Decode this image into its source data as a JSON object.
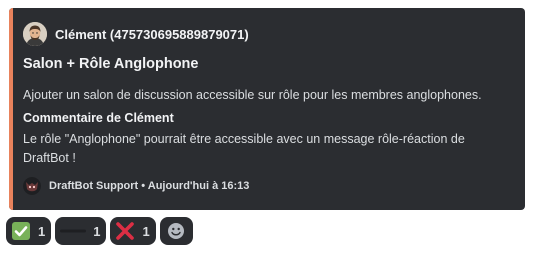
{
  "embed": {
    "accent_color": "#e8825c",
    "author": {
      "name": "Clément (475730695889879071)",
      "avatar_icon": "user-avatar"
    },
    "title": "Salon + Rôle Anglophone",
    "description": "Ajouter un salon de discussion accessible sur rôle pour les membres anglophones.",
    "field": {
      "name": "Commentaire de Clément",
      "value": "Le rôle \"Anglophone\" pourrait être accessible avec un message rôle-réaction de DraftBot !"
    },
    "footer": {
      "text": "DraftBot Support • Aujourd'hui à 16:13",
      "icon": "draftbot-icon"
    }
  },
  "reactions": [
    {
      "emoji": "check-mark-icon",
      "count": "1"
    },
    {
      "emoji": "dash-icon",
      "count": "1"
    },
    {
      "emoji": "cross-mark-icon",
      "count": "1"
    },
    {
      "emoji": "add-reaction-icon"
    }
  ]
}
